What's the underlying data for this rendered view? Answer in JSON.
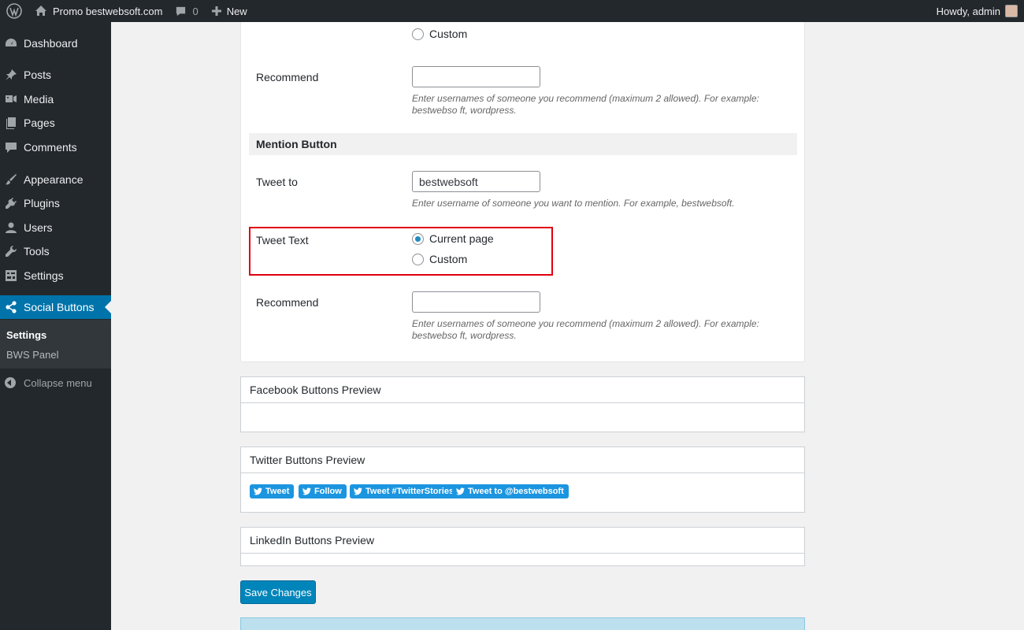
{
  "adminbar": {
    "site_name": "Promo bestwebsoft.com",
    "comments_count": "0",
    "new_label": "New",
    "greeting": "Howdy, admin"
  },
  "sidebar": {
    "items": [
      {
        "label": "Dashboard",
        "icon": "dashboard-icon"
      },
      {
        "label": "Posts",
        "icon": "pin-icon"
      },
      {
        "label": "Media",
        "icon": "media-icon"
      },
      {
        "label": "Pages",
        "icon": "pages-icon"
      },
      {
        "label": "Comments",
        "icon": "comment-icon"
      },
      {
        "label": "Appearance",
        "icon": "brush-icon"
      },
      {
        "label": "Plugins",
        "icon": "plug-icon"
      },
      {
        "label": "Users",
        "icon": "user-icon"
      },
      {
        "label": "Tools",
        "icon": "wrench-icon"
      },
      {
        "label": "Settings",
        "icon": "settings-icon"
      },
      {
        "label": "Social Buttons",
        "icon": "share-icon"
      }
    ],
    "submenu": [
      "Settings",
      "BWS Panel"
    ],
    "collapse_label": "Collapse menu"
  },
  "form": {
    "top_radio_custom": "Custom",
    "recommend_label": "Recommend",
    "recommend_value": "",
    "recommend_desc": "Enter usernames of someone you recommend (maximum 2 allowed). For example: bestwebso ft, wordpress.",
    "mention_section_title": "Mention Button",
    "tweet_to_label": "Tweet to",
    "tweet_to_value": "bestwebsoft",
    "tweet_to_desc": "Enter username of someone you want to mention. For example, bestwebsoft.",
    "tweet_text_label": "Tweet Text",
    "tweet_text_options": [
      "Current page",
      "Custom"
    ],
    "tweet_text_selected": "Current page",
    "recommend2_label": "Recommend",
    "recommend2_value": "",
    "recommend2_desc": "Enter usernames of someone you recommend (maximum 2 allowed). For example: bestwebso ft, wordpress."
  },
  "previews": {
    "facebook_title": "Facebook Buttons Preview",
    "twitter_title": "Twitter Buttons Preview",
    "twitter_buttons": [
      "Tweet",
      "Follow",
      "Tweet #TwitterStories",
      "Tweet to @bestwebsoft"
    ],
    "linkedin_title": "LinkedIn Buttons Preview"
  },
  "save_label": "Save Changes",
  "colors": {
    "admin_bar": "#23282d",
    "accent": "#0073aa",
    "twitter_blue": "#1b95e0",
    "highlight_red": "#e0000f"
  }
}
